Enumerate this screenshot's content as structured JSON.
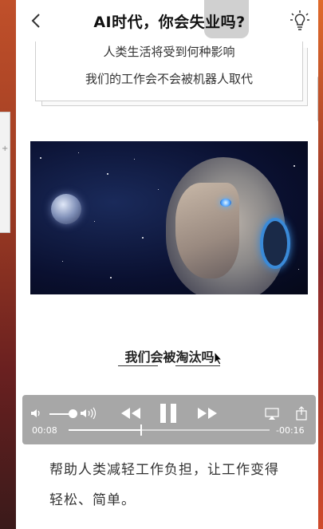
{
  "header": {
    "title": "AI时代，你会失业吗?",
    "back_icon": "chevron-left-icon",
    "action_icon": "lightbulb-icon"
  },
  "card": {
    "lines": [
      "人类生活将受到何种影响",
      "我们的工作会不会被机器人取代"
    ]
  },
  "hero": {
    "image_icon": "robot-head-space-image"
  },
  "subtitle": "我们会被淘汰吗",
  "player": {
    "elapsed": "00:08",
    "remaining": "-00:16",
    "progress": 0.36,
    "volume": 0.8,
    "state": "playing"
  },
  "body": {
    "paragraph_line1": "帮助人类减轻工作负担，让工作变得",
    "paragraph_line2": "轻松、简单。"
  },
  "colors": {
    "accent_glow": "#3a8ad8",
    "player_bg": "#a0a0a0",
    "text": "#333333"
  }
}
